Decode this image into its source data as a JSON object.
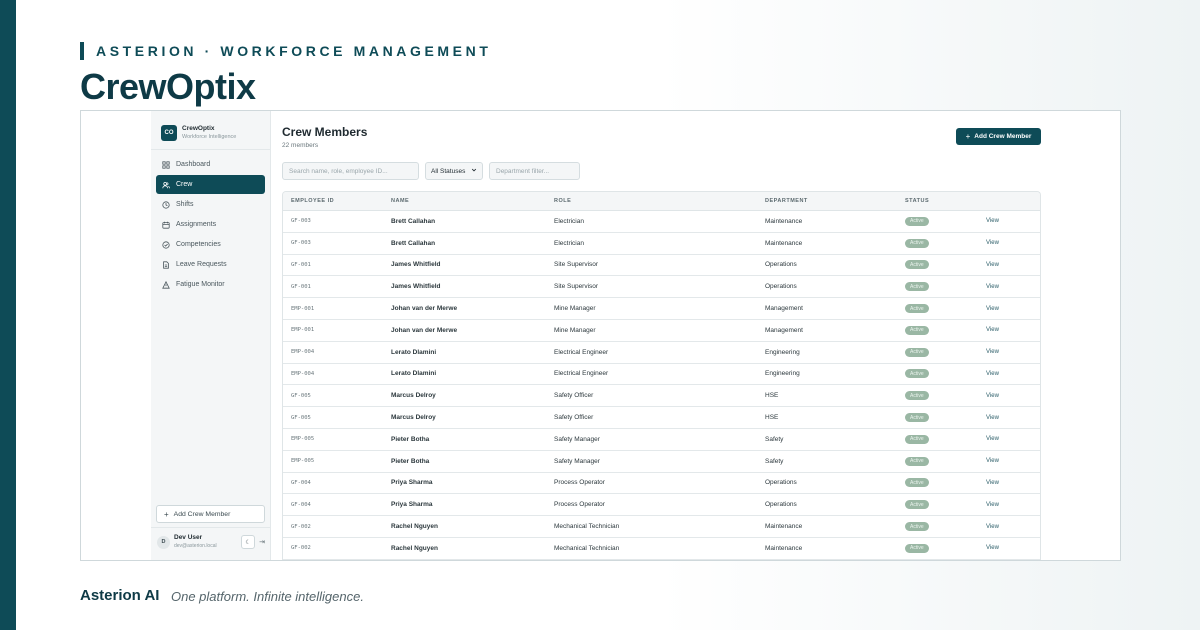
{
  "header": {
    "eyebrow": "ASTERION · WORKFORCE MANAGEMENT",
    "title": "CrewOptix"
  },
  "sidebar": {
    "logo_initials": "CO",
    "app_name": "CrewOptix",
    "app_tagline": "Workforce Intelligence",
    "items": [
      {
        "label": "Dashboard",
        "icon": "grid-icon"
      },
      {
        "label": "Crew",
        "icon": "users-icon"
      },
      {
        "label": "Shifts",
        "icon": "clock-icon"
      },
      {
        "label": "Assignments",
        "icon": "calendar-icon"
      },
      {
        "label": "Competencies",
        "icon": "check-circle-icon"
      },
      {
        "label": "Leave Requests",
        "icon": "document-icon"
      },
      {
        "label": "Fatigue Monitor",
        "icon": "warning-icon"
      }
    ],
    "add_label": "Add Crew Member",
    "user": {
      "initial": "D",
      "name": "Dev User",
      "email": "dev@asterion.local"
    }
  },
  "main": {
    "title": "Crew Members",
    "count": "22 members",
    "add_button": "Add Crew Member",
    "search_placeholder": "Search name, role, employee ID...",
    "status_filter": "All Statuses",
    "department_placeholder": "Department filter...",
    "columns": [
      "EMPLOYEE ID",
      "NAME",
      "ROLE",
      "DEPARTMENT",
      "STATUS"
    ],
    "rows": [
      {
        "id": "GF-003",
        "name": "Brett Callahan",
        "role": "Electrician",
        "dept": "Maintenance",
        "status": "Active",
        "action": "View"
      },
      {
        "id": "GF-003",
        "name": "Brett Callahan",
        "role": "Electrician",
        "dept": "Maintenance",
        "status": "Active",
        "action": "View"
      },
      {
        "id": "GF-001",
        "name": "James Whitfield",
        "role": "Site Supervisor",
        "dept": "Operations",
        "status": "Active",
        "action": "View"
      },
      {
        "id": "GF-001",
        "name": "James Whitfield",
        "role": "Site Supervisor",
        "dept": "Operations",
        "status": "Active",
        "action": "View"
      },
      {
        "id": "EMP-001",
        "name": "Johan van der Merwe",
        "role": "Mine Manager",
        "dept": "Management",
        "status": "Active",
        "action": "View"
      },
      {
        "id": "EMP-001",
        "name": "Johan van der Merwe",
        "role": "Mine Manager",
        "dept": "Management",
        "status": "Active",
        "action": "View"
      },
      {
        "id": "EMP-004",
        "name": "Lerato Dlamini",
        "role": "Electrical Engineer",
        "dept": "Engineering",
        "status": "Active",
        "action": "View"
      },
      {
        "id": "EMP-004",
        "name": "Lerato Dlamini",
        "role": "Electrical Engineer",
        "dept": "Engineering",
        "status": "Active",
        "action": "View"
      },
      {
        "id": "GF-005",
        "name": "Marcus Delroy",
        "role": "Safety Officer",
        "dept": "HSE",
        "status": "Active",
        "action": "View"
      },
      {
        "id": "GF-005",
        "name": "Marcus Delroy",
        "role": "Safety Officer",
        "dept": "HSE",
        "status": "Active",
        "action": "View"
      },
      {
        "id": "EMP-005",
        "name": "Pieter Botha",
        "role": "Safety Manager",
        "dept": "Safety",
        "status": "Active",
        "action": "View"
      },
      {
        "id": "EMP-005",
        "name": "Pieter Botha",
        "role": "Safety Manager",
        "dept": "Safety",
        "status": "Active",
        "action": "View"
      },
      {
        "id": "GF-004",
        "name": "Priya Sharma",
        "role": "Process Operator",
        "dept": "Operations",
        "status": "Active",
        "action": "View"
      },
      {
        "id": "GF-004",
        "name": "Priya Sharma",
        "role": "Process Operator",
        "dept": "Operations",
        "status": "Active",
        "action": "View"
      },
      {
        "id": "GF-002",
        "name": "Rachel Nguyen",
        "role": "Mechanical Technician",
        "dept": "Maintenance",
        "status": "Active",
        "action": "View"
      },
      {
        "id": "GF-002",
        "name": "Rachel Nguyen",
        "role": "Mechanical Technician",
        "dept": "Maintenance",
        "status": "Active",
        "action": "View"
      }
    ]
  },
  "footer": {
    "brand": "Asterion AI",
    "tagline": "One platform. Infinite intelligence."
  },
  "colors": {
    "accent": "#0e4b57",
    "status_active": "#9ab7a4"
  }
}
